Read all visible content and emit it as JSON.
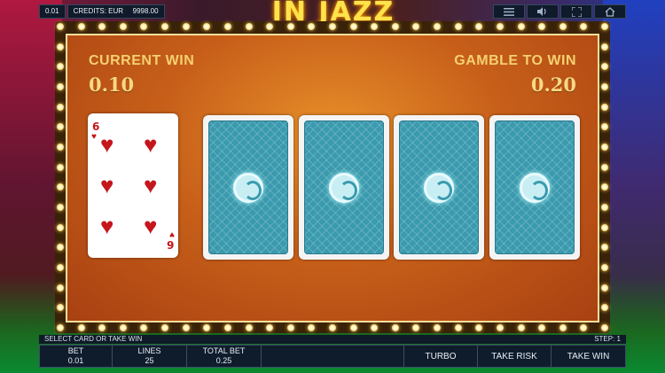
{
  "topbar": {
    "bet_value": "0.01",
    "credits_label": "CREDITS: EUR",
    "credits_value": "9998.00",
    "icons": [
      "menu-icon",
      "speaker-icon",
      "fullscreen-icon",
      "home-icon"
    ]
  },
  "title": "IN JAZZ",
  "gamble": {
    "current_win_label": "CURRENT WIN",
    "current_win_value": "0.10",
    "gamble_to_win_label": "GAMBLE TO WIN",
    "gamble_to_win_value": "0.20",
    "dealer_card": {
      "rank": "6",
      "suit": "hearts",
      "color": "#c4161c"
    },
    "card_back_color": "#3a9aae"
  },
  "message_bar": {
    "message": "SELECT CARD OR TAKE WIN",
    "step": "STEP: 1"
  },
  "bottom_bar": {
    "bet_label": "BET",
    "bet_value": "0.01",
    "lines_label": "LINES",
    "lines_value": "25",
    "total_bet_label": "TOTAL BET",
    "total_bet_value": "0.25",
    "turbo": "TURBO",
    "take_risk": "TAKE RISK",
    "take_win": "TAKE WIN"
  }
}
